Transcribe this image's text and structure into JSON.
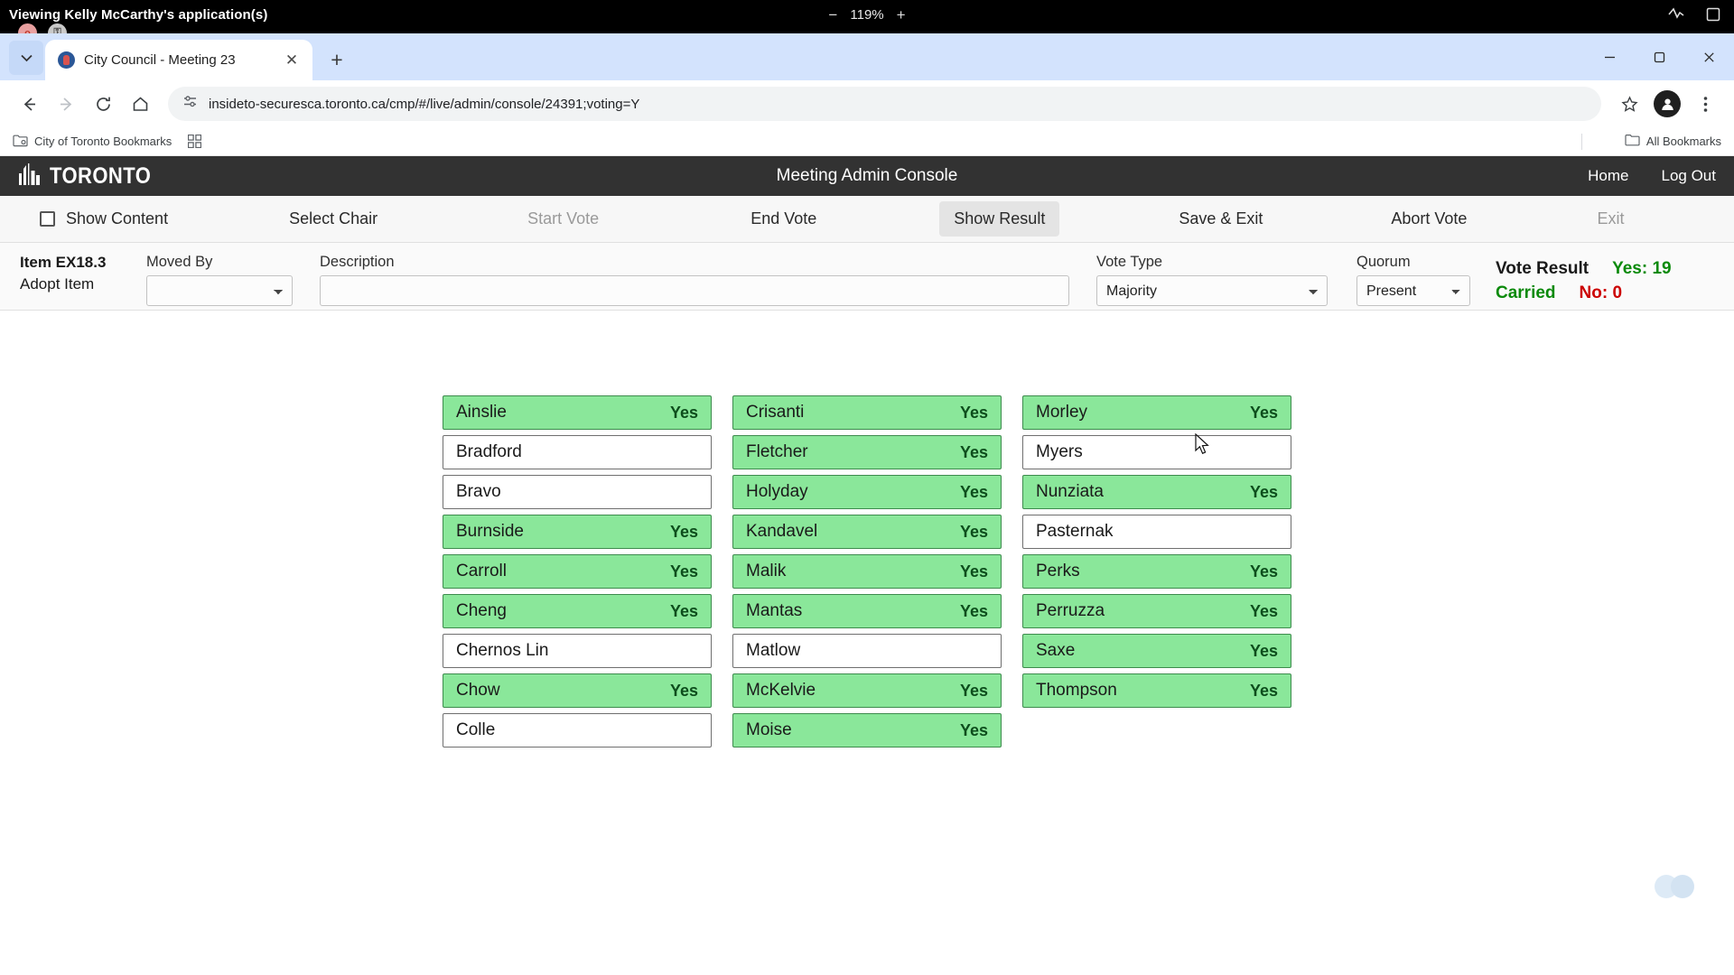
{
  "os_bar": {
    "session_title": "Viewing Kelly McCarthy's application(s)",
    "zoom_out": "−",
    "zoom_level": "119%",
    "zoom_in": "+",
    "pip_record": "o",
    "pip_key": "⚿"
  },
  "browser": {
    "tab": {
      "title": "City Council - Meeting 23",
      "close": "✕",
      "new_tab": "+"
    },
    "url": "insideto-securesca.toronto.ca/cmp/#/live/admin/console/24391;voting=Y",
    "window_controls": {
      "minimize": "−",
      "maximize": "□",
      "close": "✕"
    },
    "bookmarks": {
      "folder": "City of Toronto Bookmarks",
      "all_bookmarks": "All Bookmarks"
    }
  },
  "app": {
    "brand": "TORONTO",
    "title": "Meeting Admin Console",
    "links": [
      {
        "label": "Home"
      },
      {
        "label": "Log Out"
      }
    ]
  },
  "toolbar": [
    {
      "label": "Show Content",
      "state": "checkbox"
    },
    {
      "label": "Select Chair",
      "state": "enabled"
    },
    {
      "label": "Start Vote",
      "state": "disabled"
    },
    {
      "label": "End Vote",
      "state": "enabled"
    },
    {
      "label": "Show Result",
      "state": "active"
    },
    {
      "label": "Save & Exit",
      "state": "enabled"
    },
    {
      "label": "Abort Vote",
      "state": "enabled"
    },
    {
      "label": "Exit",
      "state": "disabled"
    }
  ],
  "item": {
    "id": "Item EX18.3",
    "action": "Adopt Item",
    "moved_by_label": "Moved By",
    "moved_by_value": "",
    "description_label": "Description",
    "description_value": "",
    "description_placeholder": "",
    "vote_type_label": "Vote Type",
    "vote_type_value": "Majority",
    "quorum_label": "Quorum",
    "quorum_value": "Present"
  },
  "result": {
    "label": "Vote Result",
    "outcome": "Carried",
    "yes": "Yes: 19",
    "no": "No: 0"
  },
  "votes": {
    "columns": [
      [
        {
          "name": "Ainslie",
          "vote": "Yes"
        },
        {
          "name": "Bradford",
          "vote": ""
        },
        {
          "name": "Bravo",
          "vote": ""
        },
        {
          "name": "Burnside",
          "vote": "Yes"
        },
        {
          "name": "Carroll",
          "vote": "Yes"
        },
        {
          "name": "Cheng",
          "vote": "Yes"
        },
        {
          "name": "Chernos Lin",
          "vote": ""
        },
        {
          "name": "Chow",
          "vote": "Yes"
        },
        {
          "name": "Colle",
          "vote": ""
        }
      ],
      [
        {
          "name": "Crisanti",
          "vote": "Yes"
        },
        {
          "name": "Fletcher",
          "vote": "Yes"
        },
        {
          "name": "Holyday",
          "vote": "Yes"
        },
        {
          "name": "Kandavel",
          "vote": "Yes"
        },
        {
          "name": "Malik",
          "vote": "Yes"
        },
        {
          "name": "Mantas",
          "vote": "Yes"
        },
        {
          "name": "Matlow",
          "vote": ""
        },
        {
          "name": "McKelvie",
          "vote": "Yes"
        },
        {
          "name": "Moise",
          "vote": "Yes"
        }
      ],
      [
        {
          "name": "Morley",
          "vote": "Yes"
        },
        {
          "name": "Myers",
          "vote": ""
        },
        {
          "name": "Nunziata",
          "vote": "Yes"
        },
        {
          "name": "Pasternak",
          "vote": ""
        },
        {
          "name": "Perks",
          "vote": "Yes"
        },
        {
          "name": "Perruzza",
          "vote": "Yes"
        },
        {
          "name": "Saxe",
          "vote": "Yes"
        },
        {
          "name": "Thompson",
          "vote": "Yes"
        }
      ]
    ]
  },
  "colors": {
    "yes_bg": "#8ae79a",
    "yes_text": "#0d4d1c",
    "header_bg": "#323232",
    "carried": "#0b8a0b",
    "no_text": "#cc0000"
  }
}
